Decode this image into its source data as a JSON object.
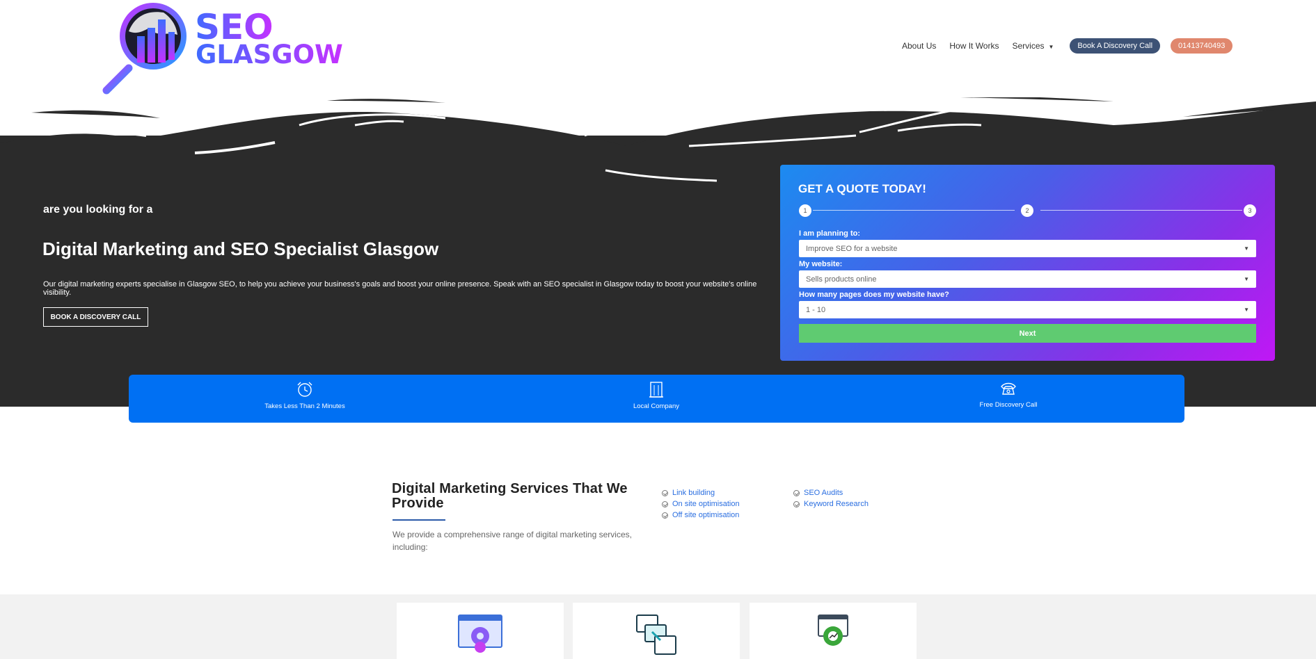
{
  "brand": {
    "line1": "SEO",
    "line2": "GLASGOW"
  },
  "nav": {
    "about": "About Us",
    "how": "How It Works",
    "services": "Services",
    "book": "Book A Discovery Call",
    "phone": "01413740493"
  },
  "hero": {
    "eyebrow": "are you looking for a",
    "title": "Digital Marketing and SEO Specialist Glasgow",
    "description": "Our digital marketing experts specialise in Glasgow SEO, to help you achieve your business's goals and boost your online presence. Speak with an SEO specialist in Glasgow today to boost your website's online visibility.",
    "button": "BOOK A DISCOVERY CALL"
  },
  "quote": {
    "title": "GET A QUOTE TODAY!",
    "steps": [
      "1",
      "2",
      "3"
    ],
    "planning_label": "I am planning to:",
    "planning_value": "Improve SEO for a website",
    "website_label": "My website:",
    "website_value": "Sells products online",
    "pages_label": "How many pages does my website have?",
    "pages_value": "1 - 10",
    "next": "Next"
  },
  "features": [
    {
      "icon": "alarm-clock-icon",
      "label": "Takes Less Than 2 Minutes"
    },
    {
      "icon": "building-icon",
      "label": "Local Company"
    },
    {
      "icon": "phone-icon",
      "label": "Free Discovery Call"
    }
  ],
  "services": {
    "title": "Digital Marketing Services That We Provide",
    "description": "We provide a comprehensive range of digital marketing services, including:",
    "col1": [
      "Link building",
      "On site optimisation",
      "Off site optimisation"
    ],
    "col2": [
      "SEO Audits",
      "Keyword Research"
    ]
  },
  "colors": {
    "hero_bg": "#2b2b2b",
    "feature_bar": "#0070f3",
    "next_button": "#5fcb71",
    "nav_dark": "#3d5275",
    "nav_orange": "#e0876d",
    "link": "#2a6ee0"
  },
  "cards": [
    {
      "icon": "settings-web-icon"
    },
    {
      "icon": "link-pages-icon"
    },
    {
      "icon": "growth-gear-icon"
    }
  ]
}
